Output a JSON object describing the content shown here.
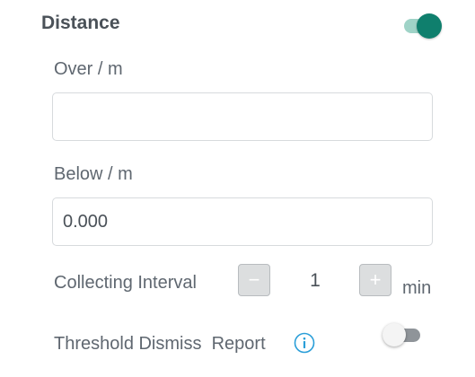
{
  "distance": {
    "title": "Distance",
    "enabled": true,
    "over": {
      "label": "Over / m",
      "value": "",
      "placeholder": ""
    },
    "below": {
      "label": "Below / m",
      "value": "0.000",
      "placeholder": ""
    },
    "collecting_interval": {
      "label": "Collecting Interval",
      "decrement": "−",
      "value": "1",
      "increment": "+",
      "unit": "min"
    },
    "threshold_dismiss_report": {
      "label": "Threshold Dismiss  Report",
      "enabled": false,
      "info_icon": "info-circle-icon"
    }
  },
  "colors": {
    "accent": "#0f7f6d",
    "accent_track": "#9fd3c7",
    "info": "#2a9ed8",
    "text": "#5f6770",
    "title": "#4a5158"
  }
}
